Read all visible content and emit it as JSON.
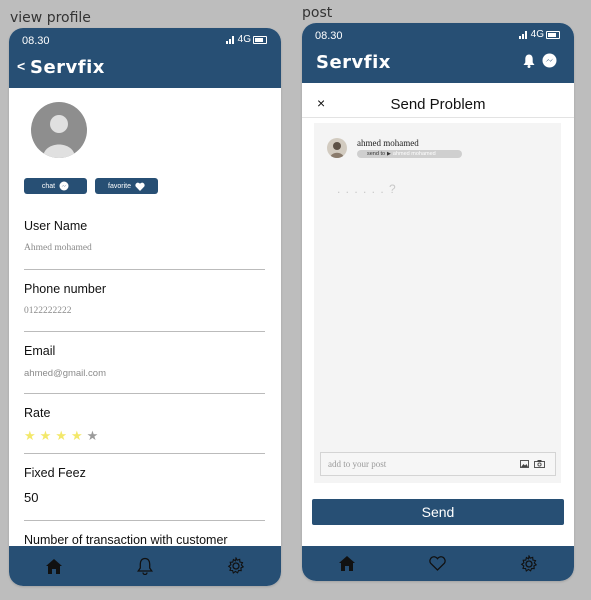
{
  "frames": {
    "profile_label": "view profile",
    "post_label": "post"
  },
  "status": {
    "time": "08.30",
    "network": "4G"
  },
  "profile": {
    "app_title": "Servfix",
    "back": "<",
    "chat_label": "chat",
    "favorite_label": "favorite",
    "fields": [
      {
        "label": "User Name",
        "value": "Ahmed mohamed"
      },
      {
        "label": "Phone number",
        "value": "0122222222"
      },
      {
        "label": "Email",
        "value": "ahmed@gmail.com"
      },
      {
        "label": "Rate",
        "rating": 4,
        "max": 5
      },
      {
        "label": "Fixed Feez",
        "value": "50"
      },
      {
        "label": "Number of transaction with customer"
      }
    ]
  },
  "post": {
    "app_title": "Servfix",
    "dialog_title": "Send Problem",
    "close": "×",
    "author": "ahmed mohamed",
    "send_to_label": "send to",
    "send_to_name": "ahmed mohamed",
    "body_placeholder": ". . . . . . ?",
    "add_placeholder": "add to your post",
    "send_label": "Send"
  },
  "colors": {
    "header": "#274f74",
    "star_on": "#f3e86a",
    "star_off": "#9a9a9a"
  }
}
